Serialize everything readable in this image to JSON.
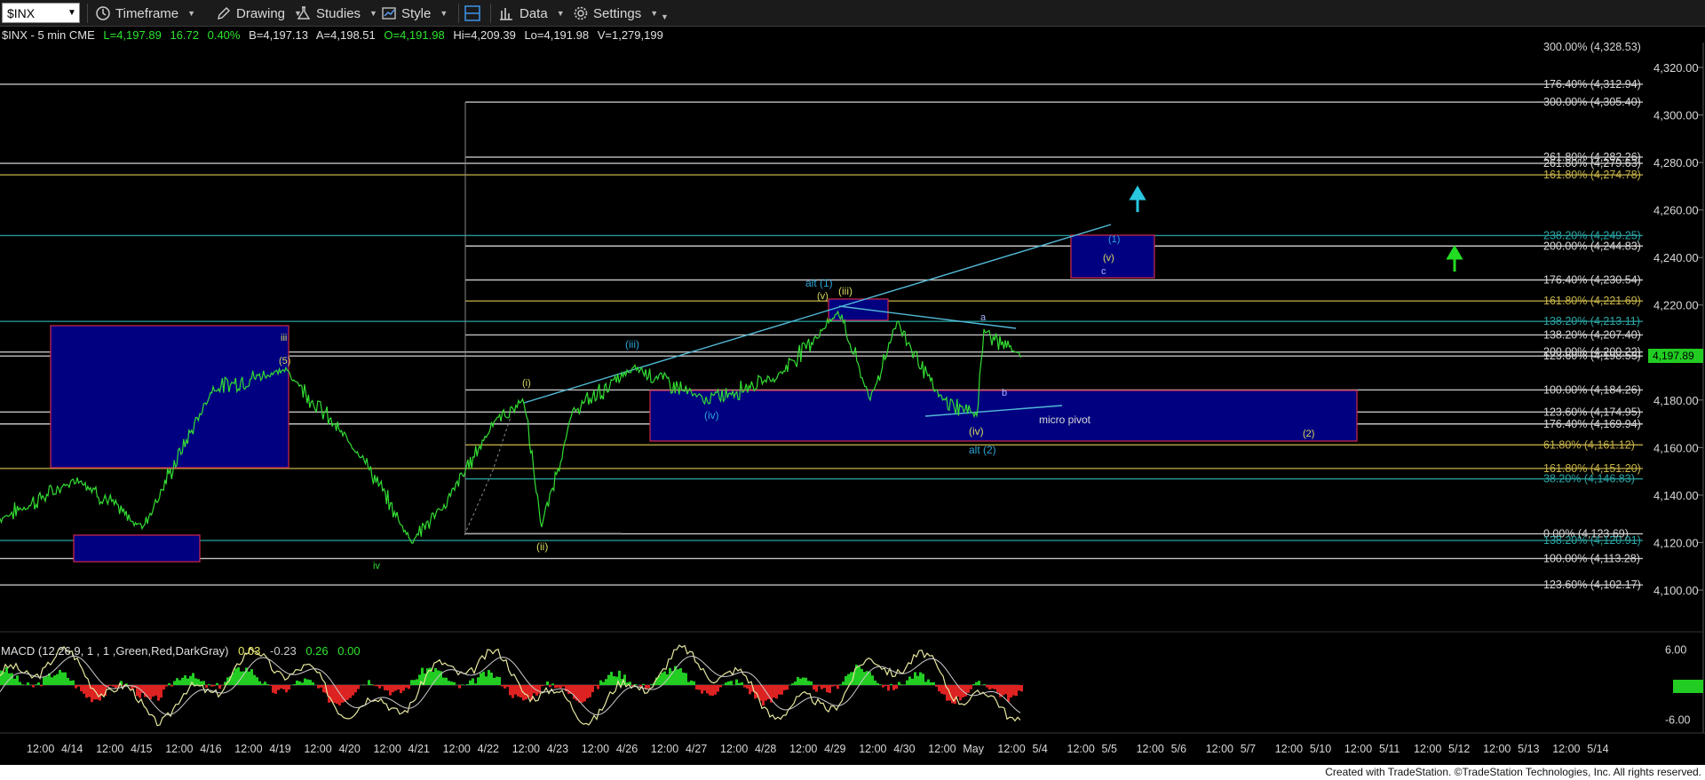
{
  "toolbar": {
    "symbol": "$INX",
    "items": [
      {
        "label": "Timeframe",
        "icon": "clock-icon"
      },
      {
        "label": "Drawing",
        "icon": "pencil-icon"
      },
      {
        "label": "Studies",
        "icon": "flask-icon"
      },
      {
        "label": "Style",
        "icon": "chart-style-icon"
      },
      {
        "label": "Data",
        "icon": "bar-chart-icon"
      },
      {
        "label": "Settings",
        "icon": "gear-icon"
      }
    ],
    "chart_layout_icon": "layout-icon"
  },
  "infobar": {
    "symbol": "$INX - 5 min  CME",
    "last": "L=4,197.89",
    "change": "16.72",
    "pct": "0.40%",
    "bid": "B=4,197.13",
    "ask": "A=4,198.51",
    "open": "O=4,191.98",
    "high": "Hi=4,209.39",
    "low": "Lo=4,191.98",
    "volume": "V=1,279,199"
  },
  "macd": {
    "label": "MACD (12,26,9, 1 , 1 ,Green,Red,DarkGray)",
    "v1": "0.03",
    "v2": "-0.23",
    "v3": "0.26",
    "v4": "0.00",
    "axis": [
      "6.00",
      "0.26",
      "-6.00"
    ]
  },
  "chart_data": {
    "type": "line",
    "title": "$INX - 5 min",
    "series": [
      {
        "name": "$INX",
        "color": "#33dd33"
      }
    ],
    "x_ticks": [
      "12:00",
      "4/14",
      "12:00",
      "4/15",
      "12:00",
      "4/16",
      "12:00",
      "4/19",
      "12:00",
      "4/20",
      "12:00",
      "4/21",
      "12:00",
      "4/22",
      "12:00",
      "4/23",
      "12:00",
      "4/26",
      "12:00",
      "4/27",
      "12:00",
      "4/28",
      "12:00",
      "4/29",
      "12:00",
      "4/30",
      "12:00",
      "May",
      "12:00",
      "5/4",
      "12:00",
      "5/5",
      "12:00",
      "5/6",
      "12:00",
      "5/7",
      "12:00",
      "5/10",
      "12:00",
      "5/11",
      "12:00",
      "5/12",
      "12:00",
      "5/13",
      "12:00",
      "5/14"
    ],
    "y_ticks": [
      "4,320.00",
      "4,300.00",
      "4,280.00",
      "4,260.00",
      "4,240.00",
      "4,220.00",
      "4,200.00",
      "4,180.00",
      "4,160.00",
      "4,140.00",
      "4,120.00",
      "4,100.00"
    ],
    "ylim": [
      4088,
      4330
    ],
    "last_price": "4,197.89",
    "price_anchors": [
      {
        "x": "4/13 12:00",
        "y": 4130
      },
      {
        "x": "4/14",
        "y": 4147
      },
      {
        "x": "4/15",
        "y": 4126
      },
      {
        "x": "4/16",
        "y": 4185
      },
      {
        "x": "4/19",
        "y": 4193
      },
      {
        "x": "4/20",
        "y": 4155
      },
      {
        "x": "4/20 12:00",
        "y": 4121
      },
      {
        "x": "4/21",
        "y": 4135
      },
      {
        "x": "4/22",
        "y": 4170
      },
      {
        "x": "4/22 12:00",
        "y": 4180
      },
      {
        "x": "4/23",
        "y": 4126
      },
      {
        "x": "4/23 12:00",
        "y": 4175
      },
      {
        "x": "4/26",
        "y": 4194
      },
      {
        "x": "4/27",
        "y": 4180
      },
      {
        "x": "4/28",
        "y": 4190
      },
      {
        "x": "4/29",
        "y": 4217
      },
      {
        "x": "4/29 12:00",
        "y": 4180
      },
      {
        "x": "4/30",
        "y": 4213
      },
      {
        "x": "4/30 12:00",
        "y": 4180
      },
      {
        "x": "May",
        "y": 4174
      },
      {
        "x": "May",
        "y": 4209
      },
      {
        "x": "May 12:00",
        "y": 4198
      }
    ],
    "fib_levels": [
      {
        "label": "300.00% (4,328.53)",
        "value": 4328.53,
        "color": "#d8d8d8"
      },
      {
        "label": "176.40% (4,312.94)",
        "value": 4312.94,
        "color": "#d8d8d8"
      },
      {
        "label": "300.00% (4,305.40)",
        "value": 4305.4,
        "color": "#d8d8d8"
      },
      {
        "label": "261.80% (4,282.26)",
        "value": 4282.26,
        "color": "#d8d8d8"
      },
      {
        "label": "261.80% (4,279.63)",
        "value": 4279.63,
        "color": "#d8d8d8"
      },
      {
        "label": "161.80% (4,274.78)",
        "value": 4274.78,
        "color": "#c8b54a"
      },
      {
        "label": "238.20% (4,249.25)",
        "value": 4249.25,
        "color": "#2aa5a5"
      },
      {
        "label": "200.00% (4,244.83)",
        "value": 4244.83,
        "color": "#d8d8d8"
      },
      {
        "label": "176.40% (4,230.54)",
        "value": 4230.54,
        "color": "#d8d8d8"
      },
      {
        "label": "161.80% (4,221.69)",
        "value": 4221.69,
        "color": "#c8b54a"
      },
      {
        "label": "138.20% (4,213.11)",
        "value": 4213.11,
        "color": "#2aa5a5"
      },
      {
        "label": "138.20% (4,207.40)",
        "value": 4207.4,
        "color": "#d8d8d8"
      },
      {
        "label": "200.00% (4,200.22)",
        "value": 4200.22,
        "color": "#d8d8d8"
      },
      {
        "label": "123.60% (4,198.53)",
        "value": 4198.53,
        "color": "#d8d8d8"
      },
      {
        "label": "100.00% (4,184.26)",
        "value": 4184.26,
        "color": "#d8d8d8"
      },
      {
        "label": "123.60% (4,174.95)",
        "value": 4174.95,
        "color": "#d8d8d8"
      },
      {
        "label": "176.40% (4,169.94)",
        "value": 4169.94,
        "color": "#d8d8d8"
      },
      {
        "label": "61.80% (4,161.12)",
        "value": 4161.12,
        "color": "#c8b54a"
      },
      {
        "label": "161.80% (4,151.20)",
        "value": 4151.2,
        "color": "#c8b54a"
      },
      {
        "label": "38.20% (4,146.83)",
        "value": 4146.83,
        "color": "#2aa5a5"
      },
      {
        "label": "0.00% (4,123.69)",
        "value": 4123.69,
        "color": "#d8d8d8"
      },
      {
        "label": "138.20% (4,120.91)",
        "value": 4120.91,
        "color": "#2aa5a5"
      },
      {
        "label": "100.00% (4,113.28)",
        "value": 4113.28,
        "color": "#d8d8d8"
      },
      {
        "label": "123.60% (4,102.17)",
        "value": 4102.17,
        "color": "#d8d8d8"
      }
    ],
    "wave_labels": [
      {
        "text": "iii",
        "color": "#d8d860"
      },
      {
        "text": "(5)",
        "color": "#d8d860"
      },
      {
        "text": "iv",
        "color": "#33dd33"
      },
      {
        "text": "(i)",
        "color": "#d8d860"
      },
      {
        "text": "(ii)",
        "color": "#d8d860"
      },
      {
        "text": "(iii)",
        "color": "#2aa5d5"
      },
      {
        "text": "(iv)",
        "color": "#2aa5d5"
      },
      {
        "text": "alt (1)",
        "color": "#2aa5d5"
      },
      {
        "text": "(v)",
        "color": "#d8d860"
      },
      {
        "text": "(iii)",
        "color": "#d8d860"
      },
      {
        "text": "a",
        "color": "#aab4ff"
      },
      {
        "text": "b",
        "color": "#aab4ff"
      },
      {
        "text": "(iv)",
        "color": "#d8d860"
      },
      {
        "text": "alt (2)",
        "color": "#2aa5d5"
      },
      {
        "text": "micro pivot",
        "color": "#d8d8d8"
      },
      {
        "text": "(2)",
        "color": "#d8d860"
      },
      {
        "text": "(1)",
        "color": "#2aa5d5"
      },
      {
        "text": "(v)",
        "color": "#d8d860"
      },
      {
        "text": "c",
        "color": "#aab4ff"
      }
    ],
    "grid": false
  },
  "footer": {
    "text": "Created with TradeStation. ©TradeStation Technologies, Inc. All rights reserved."
  }
}
